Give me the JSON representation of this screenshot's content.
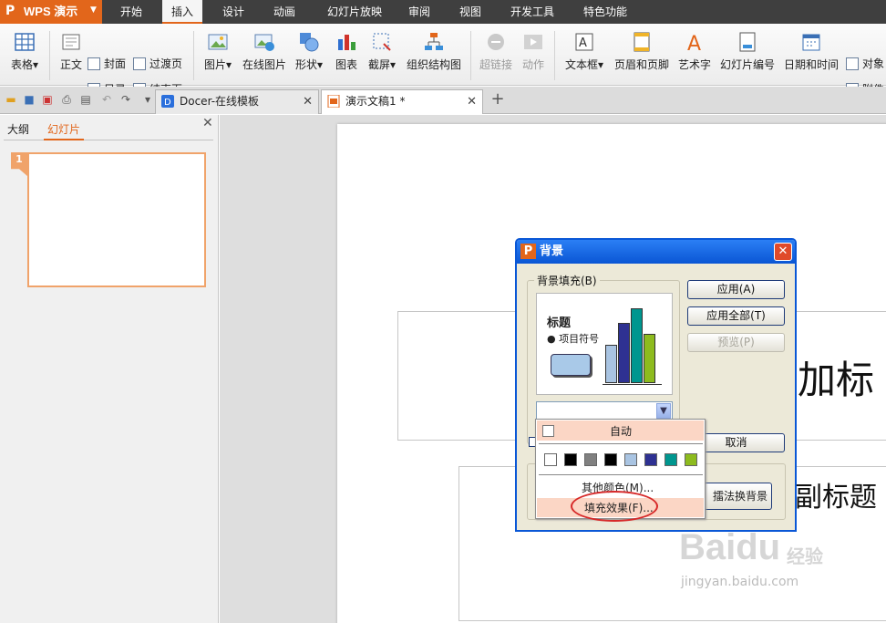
{
  "app": {
    "name": "WPS 演示",
    "logo": "P"
  },
  "menu": {
    "tabs": [
      "开始",
      "插入",
      "设计",
      "动画",
      "幻灯片放映",
      "审阅",
      "视图",
      "开发工具",
      "特色功能"
    ],
    "active": "插入"
  },
  "ribbon": {
    "table": "表格",
    "body": "正文",
    "cover": "封面",
    "toc": "目录",
    "transition": "过渡页",
    "end": "结束页",
    "picture": "图片",
    "online_picture": "在线图片",
    "shapes": "形状",
    "chart": "图表",
    "screenshot": "截屏",
    "org_chart": "组织结构图",
    "hyperlink": "超链接",
    "action": "动作",
    "textbox": "文本框",
    "header_footer": "页眉和页脚",
    "wordart": "艺术字",
    "slide_number": "幻灯片编号",
    "date_time": "日期和时间",
    "object": "对象",
    "attachment": "附件"
  },
  "tabs": {
    "docer": "Docer-在线模板",
    "document": "演示文稿1 *"
  },
  "left_pane": {
    "outline_tab": "大纲",
    "slides_tab": "幻灯片",
    "slide_number": "1"
  },
  "slide": {
    "title_text": "加标",
    "subtitle_text": "副标题"
  },
  "dialog": {
    "title": "背景",
    "fill_group_label": "背景填充(B)",
    "preview_title": "标题",
    "preview_bullet": "● 项目符号",
    "apply": "应用(A)",
    "apply_all": "应用全部(T)",
    "preview": "预览(P)",
    "cancel": "取消",
    "change_bg": "擂法换背景"
  },
  "dropdown": {
    "auto": "自动",
    "colors": [
      "#ffffff",
      "#000000",
      "#808080",
      "#000000",
      "#a9c4e2",
      "#2e3192",
      "#00968f",
      "#8dbb1e"
    ],
    "more_colors": "其他颜色(M)...",
    "fill_effect": "填充效果(F)..."
  },
  "watermark": {
    "logo": "Baidu",
    "cn": "经验",
    "url": "jingyan.baidu.com"
  }
}
